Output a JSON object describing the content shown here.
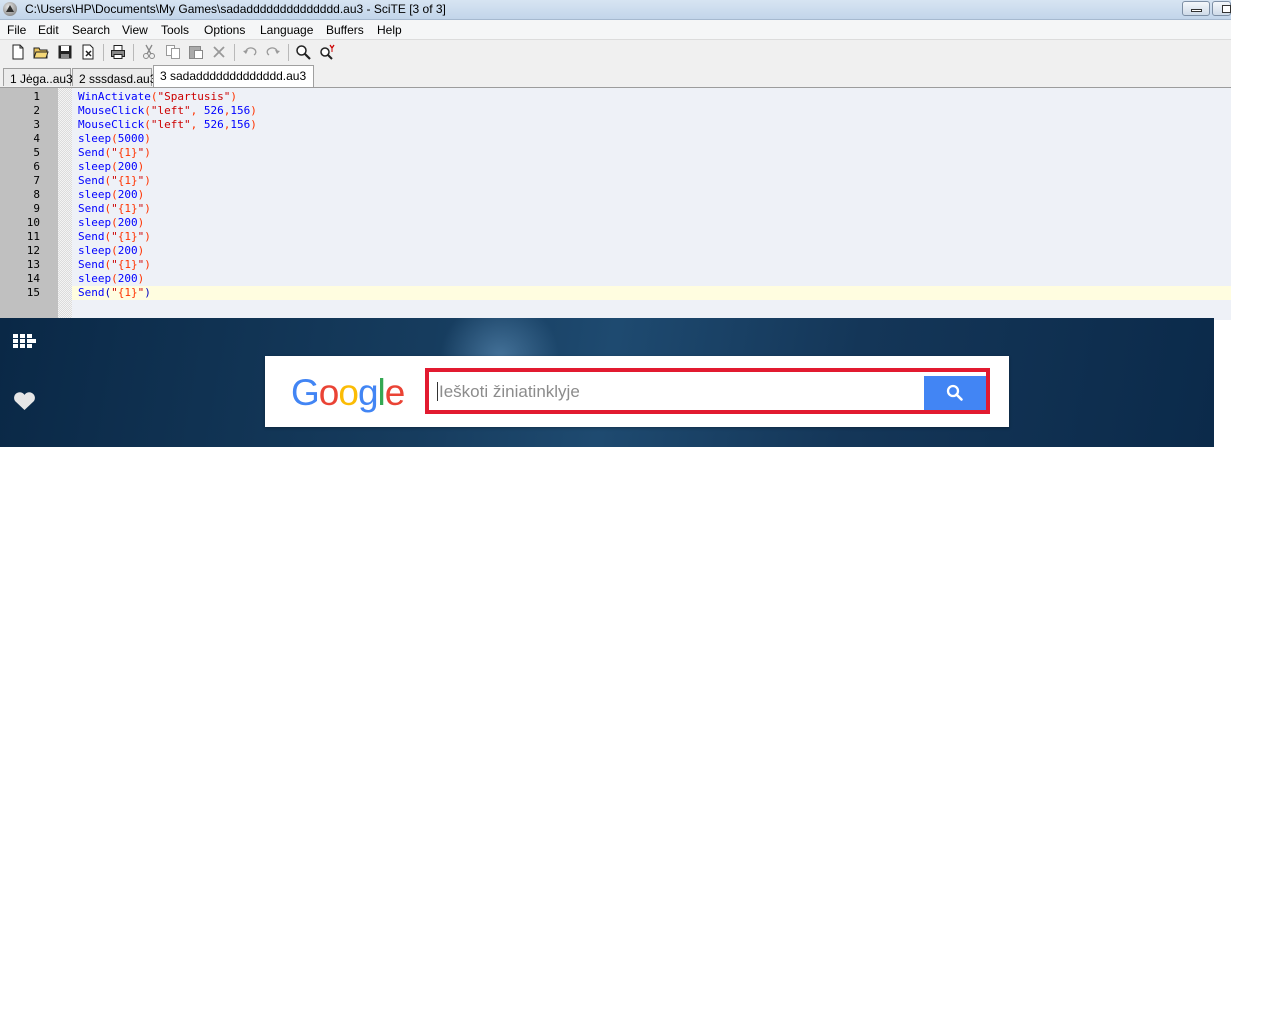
{
  "window": {
    "title": "C:\\Users\\HP\\Documents\\My Games\\sadadddddddddddddd.au3 - SciTE [3 of 3]",
    "icon": "scite-app-icon",
    "controls": [
      "minimize-icon",
      "maximize-icon"
    ]
  },
  "menu": [
    "File",
    "Edit",
    "Search",
    "View",
    "Tools",
    "Options",
    "Language",
    "Buffers",
    "Help"
  ],
  "toolbar": [
    "new-file-icon",
    "open-folder-icon",
    "save-icon",
    "close-file-icon",
    "print-icon",
    "cut-icon",
    "copy-icon",
    "paste-icon",
    "delete-icon",
    "undo-icon",
    "redo-icon",
    "find-icon",
    "replace-icon"
  ],
  "tabs": [
    {
      "label": "1 Jėga..au3",
      "active": false
    },
    {
      "label": "2 sssdasd.au3",
      "active": false
    },
    {
      "label": "3 sadaddddddddddddd.au3",
      "active": true
    }
  ],
  "editor": {
    "current_line": 15,
    "lines": [
      {
        "num": "1",
        "fn": "WinActivate",
        "args": "\"Spartusis\""
      },
      {
        "num": "2",
        "fn": "MouseClick",
        "args": "\"left\", 526,156"
      },
      {
        "num": "3",
        "fn": "MouseClick",
        "args": "\"left\", 526,156"
      },
      {
        "num": "4",
        "fn": "sleep",
        "args": "5000"
      },
      {
        "num": "5",
        "fn": "Send",
        "args": "\"{1}\""
      },
      {
        "num": "6",
        "fn": "sleep",
        "args": "200"
      },
      {
        "num": "7",
        "fn": "Send",
        "args": "\"{1}\""
      },
      {
        "num": "8",
        "fn": "sleep",
        "args": "200"
      },
      {
        "num": "9",
        "fn": "Send",
        "args": "\"{1}\""
      },
      {
        "num": "10",
        "fn": "sleep",
        "args": "200"
      },
      {
        "num": "11",
        "fn": "Send",
        "args": "\"{1}\""
      },
      {
        "num": "12",
        "fn": "sleep",
        "args": "200"
      },
      {
        "num": "13",
        "fn": "Send",
        "args": "\"{1}\""
      },
      {
        "num": "14",
        "fn": "sleep",
        "args": "200"
      },
      {
        "num": "15",
        "fn": "Send",
        "args": "\"{1}\""
      }
    ],
    "line_1": "WinActivate(\"Spartusis\")",
    "line_2": "MouseClick(\"left\", 526,156)",
    "line_3": "MouseClick(\"left\", 526,156)",
    "line_4": "sleep(5000)",
    "line_5": "Send(\"{1}\")",
    "line_6": "sleep(200)",
    "line_7": "Send(\"{1}\")",
    "line_8": "sleep(200)",
    "line_9": "Send(\"{1}\")",
    "line_10": "sleep(200)",
    "line_11": "Send(\"{1}\")",
    "line_12": "sleep(200)",
    "line_13": "Send(\"{1}\")",
    "line_14": "sleep(200)",
    "line_15": "Send(\"{1}\")"
  },
  "browser": {
    "left_icons": [
      "apps-grid-icon",
      "heart-icon"
    ],
    "logo": "Google",
    "search": {
      "placeholder": "Ieškoti žiniatinklyje",
      "value": ""
    },
    "search_button_icon": "search-icon",
    "colors": {
      "accent": "#4285f4",
      "highlight": "#e21a30"
    }
  }
}
